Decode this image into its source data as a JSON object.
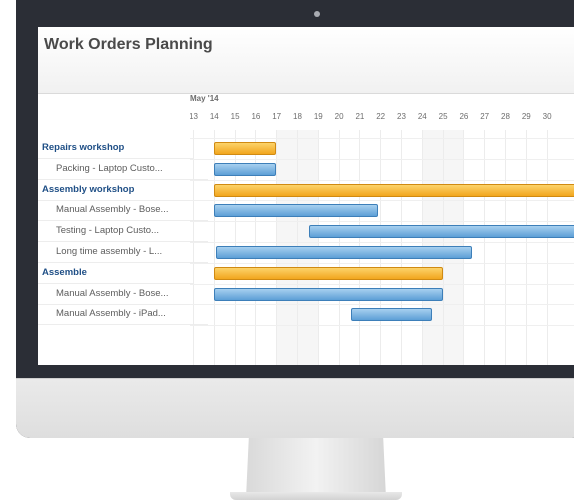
{
  "app": {
    "title": "Work Orders Planning"
  },
  "timeline": {
    "month": "May '14",
    "days": [
      "13",
      "14",
      "15",
      "16",
      "17",
      "18",
      "19",
      "20",
      "21",
      "22",
      "23",
      "24",
      "25",
      "26",
      "27",
      "28",
      "29",
      "30"
    ]
  },
  "rows": [
    {
      "label": "Repairs workshop",
      "kind": "group"
    },
    {
      "label": "Packing - Laptop Custo...",
      "kind": "task"
    },
    {
      "label": "Assembly workshop",
      "kind": "group"
    },
    {
      "label": "Manual Assembly - Bose...",
      "kind": "task"
    },
    {
      "label": "Testing - Laptop Custo...",
      "kind": "task"
    },
    {
      "label": "Long time assembly - L...",
      "kind": "task"
    },
    {
      "label": "Assemble",
      "kind": "group"
    },
    {
      "label": "Manual Assembly - Bose...",
      "kind": "task"
    },
    {
      "label": "Manual Assembly - iPad...",
      "kind": "task"
    }
  ],
  "bars": [
    {
      "row": 0,
      "start": 14.0,
      "end": 16.9,
      "color": "orange"
    },
    {
      "row": 1,
      "start": 14.0,
      "end": 16.9,
      "color": "blue"
    },
    {
      "row": 2,
      "start": 14.0,
      "end": 31.5,
      "color": "orange"
    },
    {
      "row": 3,
      "start": 14.0,
      "end": 21.8,
      "color": "blue"
    },
    {
      "row": 4,
      "start": 18.6,
      "end": 31.5,
      "color": "blue"
    },
    {
      "row": 5,
      "start": 14.1,
      "end": 26.3,
      "color": "blue"
    },
    {
      "row": 6,
      "start": 14.0,
      "end": 24.9,
      "color": "orange"
    },
    {
      "row": 7,
      "start": 14.0,
      "end": 24.9,
      "color": "blue"
    },
    {
      "row": 8,
      "start": 20.6,
      "end": 24.4,
      "color": "blue"
    }
  ],
  "colors": {
    "orange": "#f5b12a",
    "blue": "#6aa9dc",
    "group_text": "#1f4f86"
  }
}
